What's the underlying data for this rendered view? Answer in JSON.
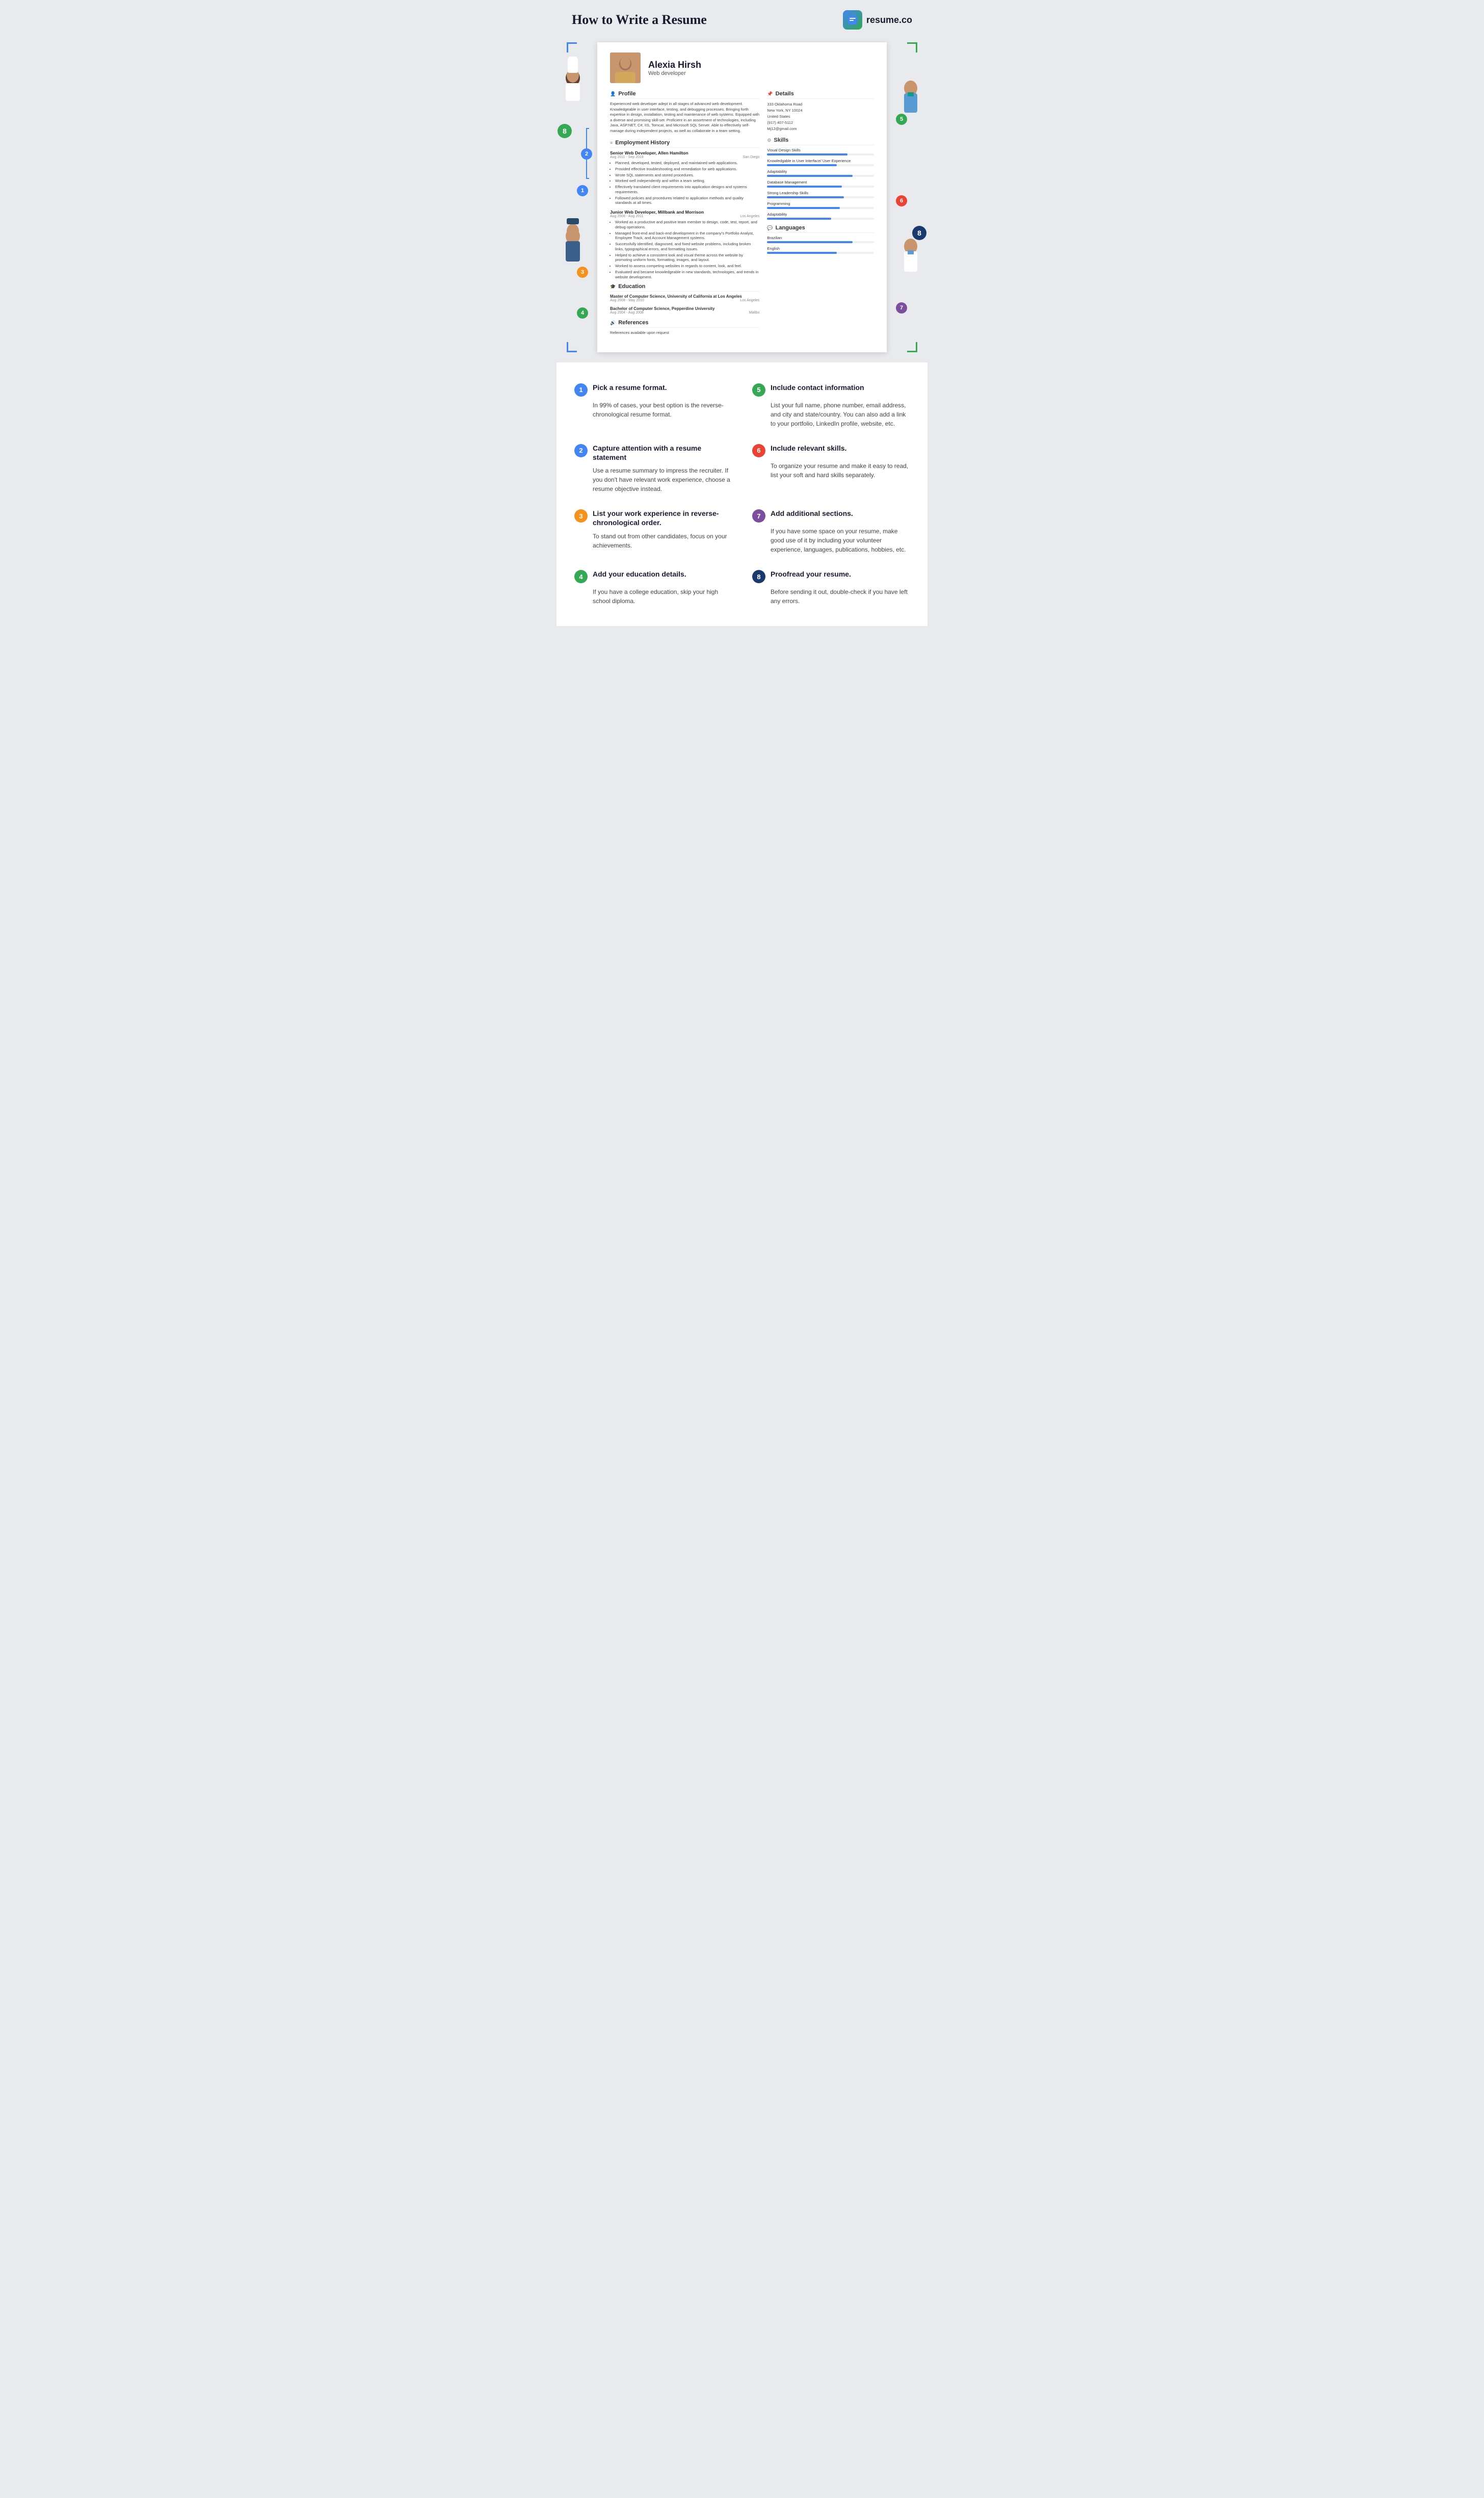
{
  "header": {
    "title": "How to Write a Resume",
    "logo_text": "resume.co",
    "logo_icon": "💬"
  },
  "resume": {
    "name": "Alexia Hirsh",
    "job_title": "Web developer",
    "profile": {
      "section_title": "Profile",
      "text": "Experienced web developer adept in all stages of advanced web development. Knowledgeable in user interface, testing, and debugging processes. Bringing forth expertise in design, installation, testing and maintenance of web systems. Equipped with a diverse and promising skill-set. Proficient in an assortment of technologies, including Java, ASP.NET, C#, IIS, Tomcat, and Microsoft SQL Server. Able to effectively self-manage during independent projects, as well as collaborate in a team setting."
    },
    "employment": {
      "section_title": "Employment History",
      "jobs": [
        {
          "title": "Senior Web Developer, Allen Hamilton",
          "location": "San Diego",
          "dates": "Aug 2011 - Sep 2019",
          "bullets": [
            "Planned, developed, tested, deployed, and maintained web applications.",
            "Provided effective troubleshooting and remediation for web applications.",
            "Wrote SQL statements and stored procedures.",
            "Worked well independently and within a team setting.",
            "Effectively translated client requirements into application designs and systems requirements.",
            "Followed policies and procedures related to application methods and quality standards at all times."
          ]
        },
        {
          "title": "Junior Web Developer, Millbank and Morrison",
          "location": "Los Angeles",
          "dates": "Aug 2008 - Aug 2011",
          "bullets": [
            "Worked as a productive and positive team member to design, code, test, report, and debug operations.",
            "Managed front-end and back-end development in the company's Portfolio Analyst, Employee Track, and Account Management systems.",
            "Successfully identified, diagnosed, and fixed website problems, including broken links, typographical errors, and formatting issues.",
            "Helped to achieve a consistent look and visual theme across the website by promoting uniform fonts, formatting, images, and layout.",
            "Worked to assess competing websites in regards to content, look, and feel.",
            "Evaluated and became knowledgeable in new standards, technologies, and trends in website development."
          ]
        }
      ]
    },
    "education": {
      "section_title": "Education",
      "items": [
        {
          "degree": "Master of Computer Science, University of California at Los Angeles",
          "location": "Los Angeles",
          "dates": "Aug 2008 - May 2010"
        },
        {
          "degree": "Bachelor of Computer Science, Pepperdine University",
          "location": "Malibu",
          "dates": "Aug 2004 - Aug 2008"
        }
      ]
    },
    "references": {
      "section_title": "References",
      "text": "References available upon request"
    },
    "details": {
      "section_title": "Details",
      "lines": [
        "333 Oklahoma Road",
        "New York, NY 10024",
        "United States",
        "(917) 407-5112",
        "Mj12@gmail.com"
      ]
    },
    "skills": {
      "section_title": "Skills",
      "items": [
        {
          "name": "Visual Design Skills",
          "pct": 75
        },
        {
          "name": "Knowledgable in User Interface/ User Experience",
          "pct": 65
        },
        {
          "name": "Adaptability",
          "pct": 80
        },
        {
          "name": "Database Management",
          "pct": 70
        },
        {
          "name": "Strong Leadership Skills",
          "pct": 72
        },
        {
          "name": "Programming",
          "pct": 68
        },
        {
          "name": "Adaptability",
          "pct": 60
        }
      ]
    },
    "languages": {
      "section_title": "Languages",
      "items": [
        {
          "name": "Brazilian",
          "pct": 80
        },
        {
          "name": "English",
          "pct": 65
        }
      ]
    }
  },
  "steps": [
    {
      "number": "1",
      "color": "#4285f4",
      "title": "Pick a resume format.",
      "body": "In 99% of cases, your best option is the reverse-chronological resume format."
    },
    {
      "number": "5",
      "color": "#34a853",
      "title": "Include contact information",
      "body": "List your full name, phone number, email address, and city and state/country. You can also add a link to your portfolio, LinkedIn profile, website, etc."
    },
    {
      "number": "2",
      "color": "#4285f4",
      "title": "Capture attention with a resume statement",
      "body": "Use a resume summary to impress the recruiter. If you don't have relevant work experience, choose a resume objective instead."
    },
    {
      "number": "6",
      "color": "#ea4335",
      "title": "Include relevant skills.",
      "body": "To organize your resume and make it easy to read, list your soft and hard skills separately."
    },
    {
      "number": "3",
      "color": "#f5921e",
      "title": "List your work experience in reverse-chronological order.",
      "body": "To stand out from other candidates, focus on your achievements."
    },
    {
      "number": "7",
      "color": "#7b4f9e",
      "title": "Add additional sections.",
      "body": "If you have some space on your resume, make good use of it by including your volunteer experience, languages, publications, hobbies, etc."
    },
    {
      "number": "4",
      "color": "#34a853",
      "title": "Add your education details.",
      "body": "If you have a college education, skip your high school diploma."
    },
    {
      "number": "8",
      "color": "#1a3a6e",
      "title": "Proofread your resume.",
      "body": "Before sending it out, double-check if you have left any errors."
    }
  ],
  "badges": {
    "b1": {
      "num": "1",
      "color": "#4285f4"
    },
    "b2": {
      "num": "2",
      "color": "#4285f4"
    },
    "b3": {
      "num": "3",
      "color": "#f5921e"
    },
    "b4": {
      "num": "4",
      "color": "#34a853"
    },
    "b5": {
      "num": "5",
      "color": "#34a853"
    },
    "b6": {
      "num": "6",
      "color": "#ea4335"
    },
    "b7": {
      "num": "7",
      "color": "#7b4f9e"
    },
    "b8": {
      "num": "8",
      "color": "#1a3a6e"
    }
  }
}
